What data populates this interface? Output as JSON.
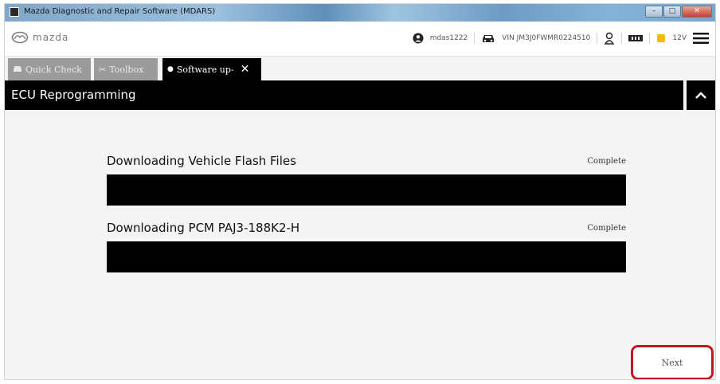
{
  "window": {
    "title": "Mazda Diagnostic and Repair Software (MDARS)",
    "controls": {
      "minimize": "–",
      "maximize": "□",
      "close": "✕"
    }
  },
  "header": {
    "brand": "mazda",
    "user_id": "mdas1222",
    "vin": "VIN JM3J0FWMR0224510",
    "battery_pct": "12V",
    "icons": [
      "user-icon",
      "car-icon",
      "person-icon",
      "vci-icon",
      "battery-icon",
      "menu-icon"
    ]
  },
  "tabs": [
    {
      "label": "Quick Check",
      "icon": "car-check-icon",
      "active": false
    },
    {
      "label": "Toolbox",
      "icon": "wrench-icon",
      "active": false
    },
    {
      "label": "Software up-",
      "icon": "dot-icon",
      "active": true,
      "closable": true
    }
  ],
  "section": {
    "title": "ECU Reprogramming"
  },
  "downloads": [
    {
      "label": "Downloading Vehicle Flash Files",
      "status": "Complete",
      "progress": 1.0
    },
    {
      "label": "Downloading PCM PAJ3-188K2-H",
      "status": "Complete",
      "progress": 1.0
    }
  ],
  "footer": {
    "next_label": "Next"
  },
  "colors": {
    "accent_highlight": "#c8141c",
    "bar": "#000000",
    "background": "#f4f4f4"
  }
}
